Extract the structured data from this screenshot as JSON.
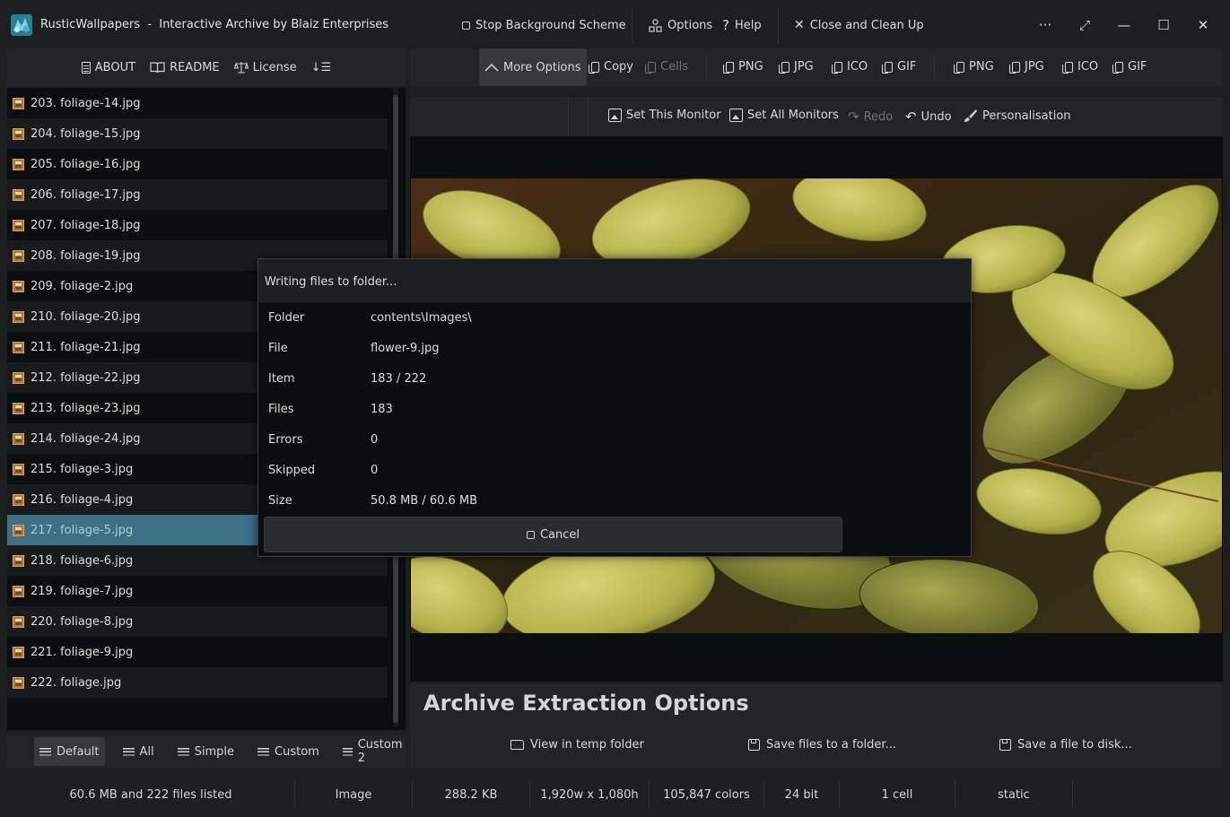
{
  "app": {
    "name": "RusticWallpapers",
    "separator": "-",
    "subtitle": "Interactive Archive by Blaiz Enterprises"
  },
  "titlebar": {
    "stop_scheme": "Stop Background Scheme",
    "options": "Options",
    "help": "Help",
    "close_clean": "Close and Clean Up",
    "more_glyph": "···",
    "expand_glyph": "⤢",
    "min_glyph": "—",
    "max_glyph": "☐",
    "close_glyph": "✕"
  },
  "left_toolbar": {
    "about": "ABOUT",
    "readme": "README",
    "license": "License",
    "sort_glyph": "↓☰"
  },
  "right_toolbar": {
    "more_options": "More Options",
    "copy": "Copy",
    "cells": "Cells",
    "group1": [
      "PNG",
      "JPG",
      "ICO",
      "GIF"
    ],
    "group2": [
      "PNG",
      "JPG",
      "ICO",
      "GIF"
    ]
  },
  "monitor_toolbar": {
    "set_this": "Set This Monitor",
    "set_all": "Set All Monitors",
    "redo": "Redo",
    "undo": "Undo",
    "personalisation": "Personalisation"
  },
  "files": [
    {
      "label": "203. foliage-14.jpg"
    },
    {
      "label": "204. foliage-15.jpg"
    },
    {
      "label": "205. foliage-16.jpg"
    },
    {
      "label": "206. foliage-17.jpg"
    },
    {
      "label": "207. foliage-18.jpg"
    },
    {
      "label": "208. foliage-19.jpg"
    },
    {
      "label": "209. foliage-2.jpg"
    },
    {
      "label": "210. foliage-20.jpg"
    },
    {
      "label": "211. foliage-21.jpg"
    },
    {
      "label": "212. foliage-22.jpg"
    },
    {
      "label": "213. foliage-23.jpg"
    },
    {
      "label": "214. foliage-24.jpg"
    },
    {
      "label": "215. foliage-3.jpg"
    },
    {
      "label": "216. foliage-4.jpg"
    },
    {
      "label": "217. foliage-5.jpg",
      "selected": true
    },
    {
      "label": "218. foliage-6.jpg"
    },
    {
      "label": "219. foliage-7.jpg"
    },
    {
      "label": "220. foliage-8.jpg"
    },
    {
      "label": "221. foliage-9.jpg"
    },
    {
      "label": "222. foliage.jpg"
    }
  ],
  "view_modes": {
    "default": "Default",
    "all": "All",
    "simple": "Simple",
    "custom": "Custom",
    "custom2": "Custom 2"
  },
  "extraction": {
    "title": "Archive Extraction Options",
    "view_temp": "View in temp folder",
    "save_folder": "Save files to a folder...",
    "save_disk": "Save a file to disk..."
  },
  "dialog": {
    "title": "Writing files to folder...",
    "rows": [
      {
        "key": "Folder",
        "value": "contents\\Images\\"
      },
      {
        "key": "File",
        "value": "flower-9.jpg"
      },
      {
        "key": "Item",
        "value": "183 / 222"
      },
      {
        "key": "Files",
        "value": "183"
      },
      {
        "key": "Errors",
        "value": "0"
      },
      {
        "key": "Skipped",
        "value": "0"
      },
      {
        "key": "Size",
        "value": "50.8 MB / 60.6 MB"
      }
    ],
    "cancel": "Cancel"
  },
  "status": {
    "listed": "60.6 MB and 222 files listed",
    "type": "Image",
    "size": "288.2 KB",
    "dimensions": "1,920w x 1,080h",
    "colors": "105,847 colors",
    "bits": "24 bit",
    "cells": "1 cell",
    "mode": "static"
  },
  "colors": {
    "selected_row": "#3c7087",
    "background": "#1c1e20",
    "panel": "#222527"
  }
}
